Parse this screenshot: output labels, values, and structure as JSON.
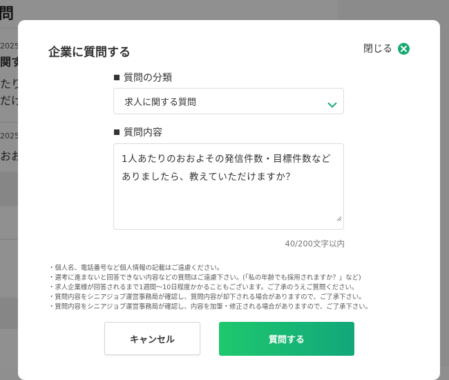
{
  "background": {
    "page_title": "問",
    "item1_date": "2025/",
    "item1_title": "関す",
    "item1_body_line1": "たり",
    "item1_body_line2": "だけ",
    "item2_date": "2025/",
    "item2_title": "おお"
  },
  "modal": {
    "title": "企業に質問する",
    "close_label": "閉じる",
    "close_icon": "close-icon",
    "category": {
      "label": "質問の分類",
      "selected": "求人に関する質問",
      "chevron_icon": "chevron-down-icon"
    },
    "content": {
      "label": "質問内容",
      "value": "1人あたりのおおよその発信件数・目標件数などありましたら、教えていただけますか？",
      "char_count": "40/200文字以内"
    },
    "notes": [
      "・個人名、電話番号など個人情報の記載はご遠慮ください。",
      "・選考に進まないと回答できない内容などの質問はご遠慮下さい。(「私の年齢でも採用されますか？」など)",
      "・求人企業様が回答されるまで1週間〜10日程度かかることもございます。ご了承のうえご質問ください。",
      "・質問内容をシニアジョブ運営事務局が確認し、質問内容が却下される場合がありますので、ご了承下さい。",
      "・質問内容をシニアジョブ運営事務局が確認し、内容を加筆・修正される場合がありますので、ご了承下さい。"
    ],
    "cancel_label": "キャンセル",
    "submit_label": "質問する"
  },
  "colors": {
    "accent": "#16a970",
    "button_gradient_start": "#1ec86e",
    "button_gradient_end": "#12a77a"
  }
}
